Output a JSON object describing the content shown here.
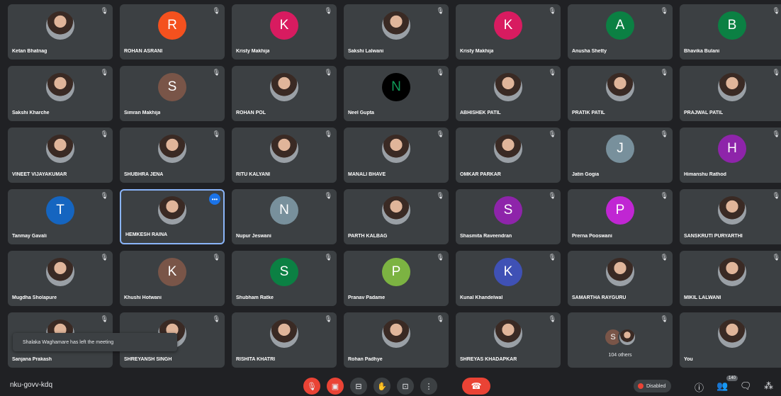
{
  "tiles": [
    {
      "name": "Ketan Bhatnag",
      "type": "photo"
    },
    {
      "name": "ROHAN ASRANI",
      "type": "letter",
      "letter": "R",
      "color": "#f4511e"
    },
    {
      "name": "Kristy Makhija",
      "type": "letter",
      "letter": "K",
      "color": "#d81b60"
    },
    {
      "name": "Sakshi Lalwani",
      "type": "photo"
    },
    {
      "name": "Kristy Makhija",
      "type": "letter",
      "letter": "K",
      "color": "#d81b60"
    },
    {
      "name": "Anusha Shetty",
      "type": "letter",
      "letter": "A",
      "color": "#0b8043"
    },
    {
      "name": "Bhavika Bulani",
      "type": "letter",
      "letter": "B",
      "color": "#0b8043"
    },
    {
      "name": "Sakshi Kharche",
      "type": "photo"
    },
    {
      "name": "Simran Makhija",
      "type": "letter",
      "letter": "S",
      "color": "#795548"
    },
    {
      "name": "ROHAN POL",
      "type": "photo"
    },
    {
      "name": "Neel Gupta",
      "type": "letter",
      "letter": "N",
      "color": "#000000",
      "fg": "#0f9d58"
    },
    {
      "name": "ABHISHEK PATIL",
      "type": "photo"
    },
    {
      "name": "PRATIK PATIL",
      "type": "photo"
    },
    {
      "name": "PRAJWAL PATIL",
      "type": "photo"
    },
    {
      "name": "VINEET VIJAYAKUMAR",
      "type": "photo"
    },
    {
      "name": "SHUBHRA JENA",
      "type": "photo"
    },
    {
      "name": "RITU KALYANI",
      "type": "photo"
    },
    {
      "name": "MANALI BHAVE",
      "type": "photo"
    },
    {
      "name": "OMKAR PARKAR",
      "type": "photo"
    },
    {
      "name": "Jatin Gogia",
      "type": "letter",
      "letter": "J",
      "color": "#78909c"
    },
    {
      "name": "Himanshu Rathod",
      "type": "letter",
      "letter": "H",
      "color": "#8e24aa"
    },
    {
      "name": "Tanmay Gavali",
      "type": "letter",
      "letter": "T",
      "color": "#1565c0"
    },
    {
      "name": "HEMKESH RAINA",
      "type": "photo",
      "active": true
    },
    {
      "name": "Nupur Jeswani",
      "type": "letter",
      "letter": "N",
      "color": "#78909c"
    },
    {
      "name": "PARTH KALBAG",
      "type": "photo"
    },
    {
      "name": "Shasmita Raveendran",
      "type": "letter",
      "letter": "S",
      "color": "#8e24aa"
    },
    {
      "name": "Prerna Pooswani",
      "type": "letter",
      "letter": "P",
      "color": "#c026d3"
    },
    {
      "name": "SANSKRUTI PURYARTHI",
      "type": "photo"
    },
    {
      "name": "Mugdha Sholapure",
      "type": "photo"
    },
    {
      "name": "Khushi Hotwani",
      "type": "letter",
      "letter": "K",
      "color": "#795548"
    },
    {
      "name": "Shubham Ratke",
      "type": "letter",
      "letter": "S",
      "color": "#0b8043"
    },
    {
      "name": "Pranav Padame",
      "type": "letter",
      "letter": "P",
      "color": "#7cb342"
    },
    {
      "name": "Kunal Khandelwal",
      "type": "letter",
      "letter": "K",
      "color": "#3f51b5"
    },
    {
      "name": "SAMARTHA RAYGURU",
      "type": "photo"
    },
    {
      "name": "MIKIL LALWANI",
      "type": "photo"
    },
    {
      "name": "Sanjana Prakash",
      "type": "photo"
    },
    {
      "name": "SHREYANSH SINGH",
      "type": "photo"
    },
    {
      "name": "RISHITA KHATRI",
      "type": "photo"
    },
    {
      "name": "Rohan Padhye",
      "type": "photo"
    },
    {
      "name": "SHREYAS KHADAPKAR",
      "type": "photo"
    },
    {
      "name": "104 others",
      "type": "others"
    },
    {
      "name": "You",
      "type": "photo",
      "self": true
    }
  ],
  "toast": "Shalaka Waghamare has left the meeting",
  "meeting_code": "nku-govv-kdq",
  "presentation_status": "Disabled",
  "participants_badge": "140",
  "icons": {
    "mic": "mic-off-icon",
    "cam": "camera-off-icon",
    "captions": "captions-icon",
    "hand": "raise-hand-icon",
    "present": "present-icon",
    "more": "more-options-icon",
    "leave": "leave-call-icon",
    "info": "info-icon",
    "people": "people-icon",
    "chat": "chat-icon",
    "activities": "activities-icon"
  },
  "colors": {
    "background": "#202124",
    "tile": "#3c4043",
    "accent": "#8ab4f8",
    "danger": "#ea4335"
  }
}
